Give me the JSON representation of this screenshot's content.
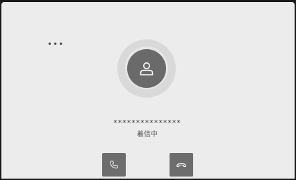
{
  "call": {
    "menu_label": "•••",
    "caller_number": "***************",
    "status": "着信中"
  },
  "icons": {
    "avatar": "person-icon",
    "answer": "phone-answer-icon",
    "decline": "phone-hangup-icon",
    "menu": "more-dots-icon"
  },
  "colors": {
    "screen_bg": "#ececec",
    "button_bg": "#6d6d6d",
    "avatar_bg": "#6a6a6a"
  }
}
